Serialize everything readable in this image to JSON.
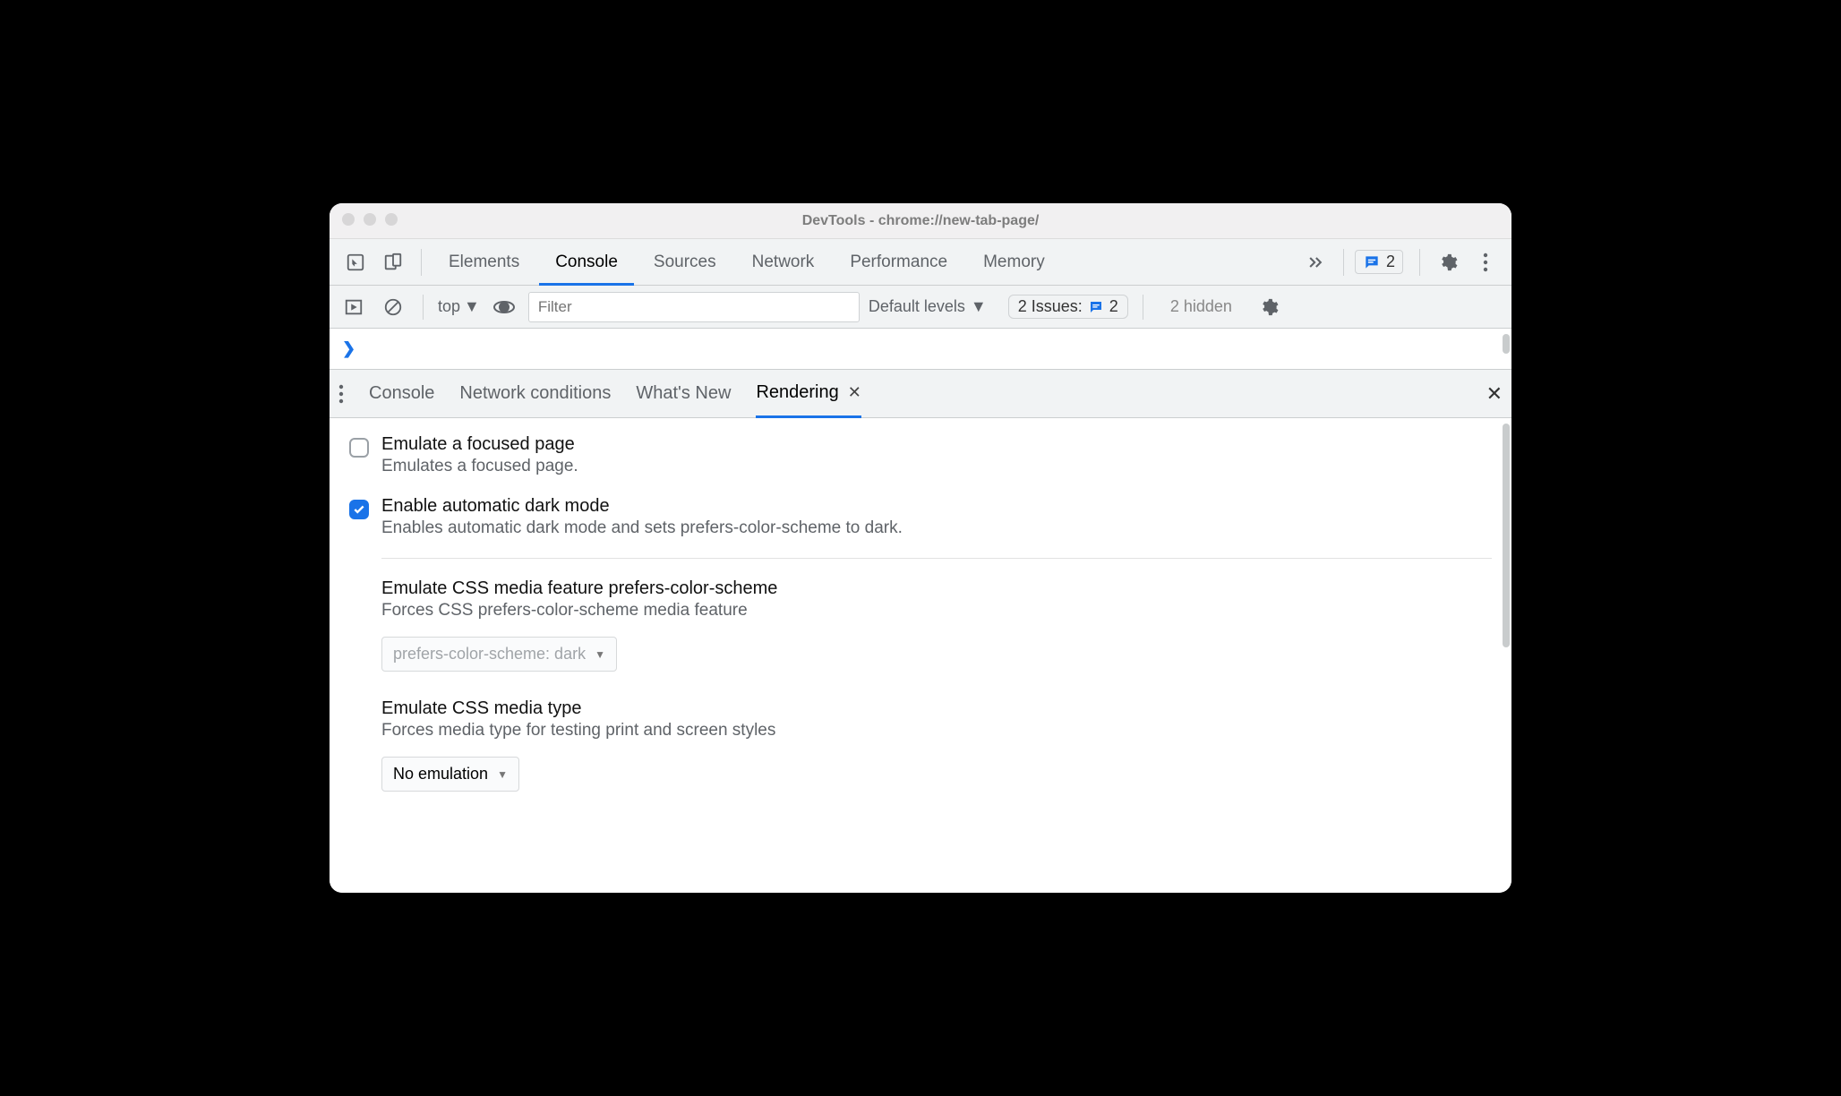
{
  "window": {
    "title": "DevTools - chrome://new-tab-page/"
  },
  "main_tabs": {
    "items": [
      "Elements",
      "Console",
      "Sources",
      "Network",
      "Performance",
      "Memory"
    ],
    "active_index": 1,
    "overflow_icon": "chevrons-right-icon",
    "messages_count": "2"
  },
  "console_toolbar": {
    "context": "top",
    "filter_placeholder": "Filter",
    "levels_label": "Default levels",
    "issues_label": "2 Issues:",
    "issues_count": "2",
    "hidden_label": "2 hidden"
  },
  "drawer": {
    "tabs": [
      "Console",
      "Network conditions",
      "What's New",
      "Rendering"
    ],
    "active_index": 3
  },
  "rendering": {
    "opt1": {
      "title": "Emulate a focused page",
      "desc": "Emulates a focused page.",
      "checked": false
    },
    "opt2": {
      "title": "Enable automatic dark mode",
      "desc": "Enables automatic dark mode and sets prefers-color-scheme to dark.",
      "checked": true
    },
    "css_scheme": {
      "title": "Emulate CSS media feature prefers-color-scheme",
      "desc": "Forces CSS prefers-color-scheme media feature",
      "value": "prefers-color-scheme: dark",
      "disabled": true
    },
    "media_type": {
      "title": "Emulate CSS media type",
      "desc": "Forces media type for testing print and screen styles",
      "value": "No emulation",
      "disabled": false
    }
  }
}
